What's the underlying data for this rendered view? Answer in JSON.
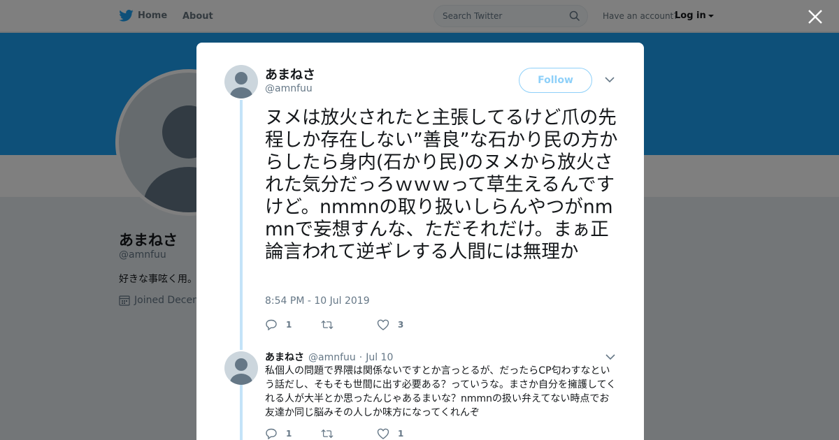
{
  "topbar": {
    "home_label": "Home",
    "about_label": "About",
    "search_placeholder": "Search Twitter",
    "account_prompt": "Have an account?",
    "login_label": "Log in"
  },
  "colors": {
    "brand_blue": "#1da1f2",
    "thread_line": "#c4e3f8",
    "follow_outline": "#8ed0f9"
  },
  "profile": {
    "name": "あまねさ",
    "handle": "@amnfuu",
    "bio": "好きな事呟く用。",
    "joined": "Joined Decem"
  },
  "tweet": {
    "name": "あまねさ",
    "handle": "@amnfuu",
    "follow_label": "Follow",
    "text": "ヌメは放火されたと主張してるけど爪の先程しか存在しない”善良”な石かり民の方からしたら身内(石かり民)のヌメから放火された気分だっろｗｗｗって草生えるんですけど。nmmnの取り扱いしらんやつがnmmnで妄想すんな、ただそれだけ。まぁ正論言われて逆ギレする人間には無理か",
    "timestamp": "8:54 PM - 10 Jul 2019",
    "reply_count": "1",
    "retweet_count": "",
    "like_count": "3"
  },
  "reply": {
    "name": "あまねさ",
    "handle": "@amnfuu",
    "separator": "·",
    "date": "Jul 10",
    "text": "私個人の問題で界隈は関係ないですとか言っとるが、だったらCP匂わすなという話だし、そもそも世間に出す必要ある？っていうな。まさか自分を擁護してくれる人が大半とか思ったんじゃあるまいな？nmmnの扱い弁えてない時点でお友達か同じ脳みその人しか味方になってくれんぞ",
    "reply_count": "1",
    "retweet_count": "",
    "like_count": "1"
  }
}
